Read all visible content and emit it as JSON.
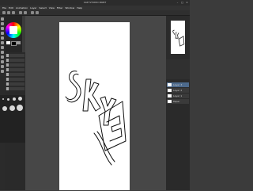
{
  "window": {
    "title": "CLIP STUDIO PAINT"
  },
  "menu": [
    "File",
    "Edit",
    "Animation",
    "Layer",
    "Select",
    "View",
    "Filter",
    "Window",
    "Help"
  ],
  "canvas": {
    "drawing": "SKYE graffiti outline sketch"
  },
  "colors": {
    "main": "#ffffff",
    "sub": "#000000",
    "canvas_bg": "#ffffff",
    "accent": "#4d6a8c"
  },
  "tools": [
    "pen-icon",
    "pencil-icon",
    "brush-icon",
    "eraser-icon",
    "fill-icon",
    "select-icon",
    "move-icon",
    "zoom-icon",
    "hand-icon",
    "eyedropper-icon",
    "text-icon",
    "shape-icon"
  ],
  "layers": [
    {
      "name": "Layer 3"
    },
    {
      "name": "Layer 2"
    },
    {
      "name": "Layer 1"
    },
    {
      "name": "Paper"
    }
  ]
}
